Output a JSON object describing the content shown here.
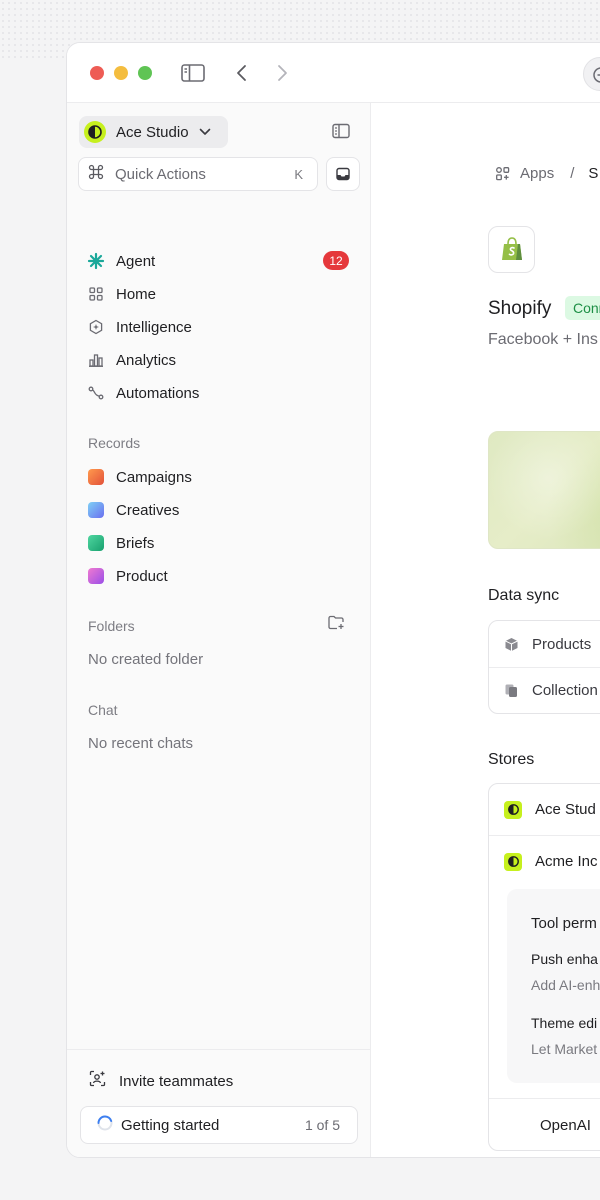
{
  "workspace": {
    "name": "Ace Studio"
  },
  "quick_actions": {
    "label": "Quick Actions",
    "shortcut": "K"
  },
  "nav": [
    {
      "label": "Agent",
      "icon": "agent-icon",
      "badge": "12"
    },
    {
      "label": "Home",
      "icon": "grid-icon"
    },
    {
      "label": "Intelligence",
      "icon": "intelligence-icon"
    },
    {
      "label": "Analytics",
      "icon": "bar-chart-icon"
    },
    {
      "label": "Automations",
      "icon": "route-icon"
    }
  ],
  "records": {
    "title": "Records",
    "items": [
      {
        "label": "Campaigns",
        "color": "#f26a3d"
      },
      {
        "label": "Creatives",
        "color": "#5b8ff0"
      },
      {
        "label": "Briefs",
        "color": "#22b07d"
      },
      {
        "label": "Product",
        "color": "#c350e8"
      }
    ]
  },
  "folders": {
    "title": "Folders",
    "empty": "No created folder"
  },
  "chat": {
    "title": "Chat",
    "empty": "No recent chats"
  },
  "footer": {
    "invite": "Invite teammates",
    "getting_started": "Getting started",
    "progress_label": "1 of 5",
    "progress": 0.2
  },
  "main": {
    "breadcrumb": {
      "root": "Apps",
      "current": "S"
    },
    "app_name": "Shopify",
    "status": "Conn",
    "subtitle": "Facebook + Ins",
    "data_sync": {
      "title": "Data sync",
      "items": [
        "Products",
        "Collection"
      ]
    },
    "stores": {
      "title": "Stores",
      "items": [
        "Ace Stud",
        "Acme Inc"
      ],
      "permissions": {
        "title": "Tool perm",
        "items": [
          {
            "name": "Push enha",
            "desc": "Add AI-enh"
          },
          {
            "name": "Theme edi",
            "desc": "Let Market"
          }
        ]
      },
      "extra": "OpenAI"
    }
  },
  "colors": {
    "accent": "#c6f01e",
    "badge": "#e5383b",
    "connected_bg": "#dcf9e3",
    "connected_text": "#1d8f45"
  }
}
